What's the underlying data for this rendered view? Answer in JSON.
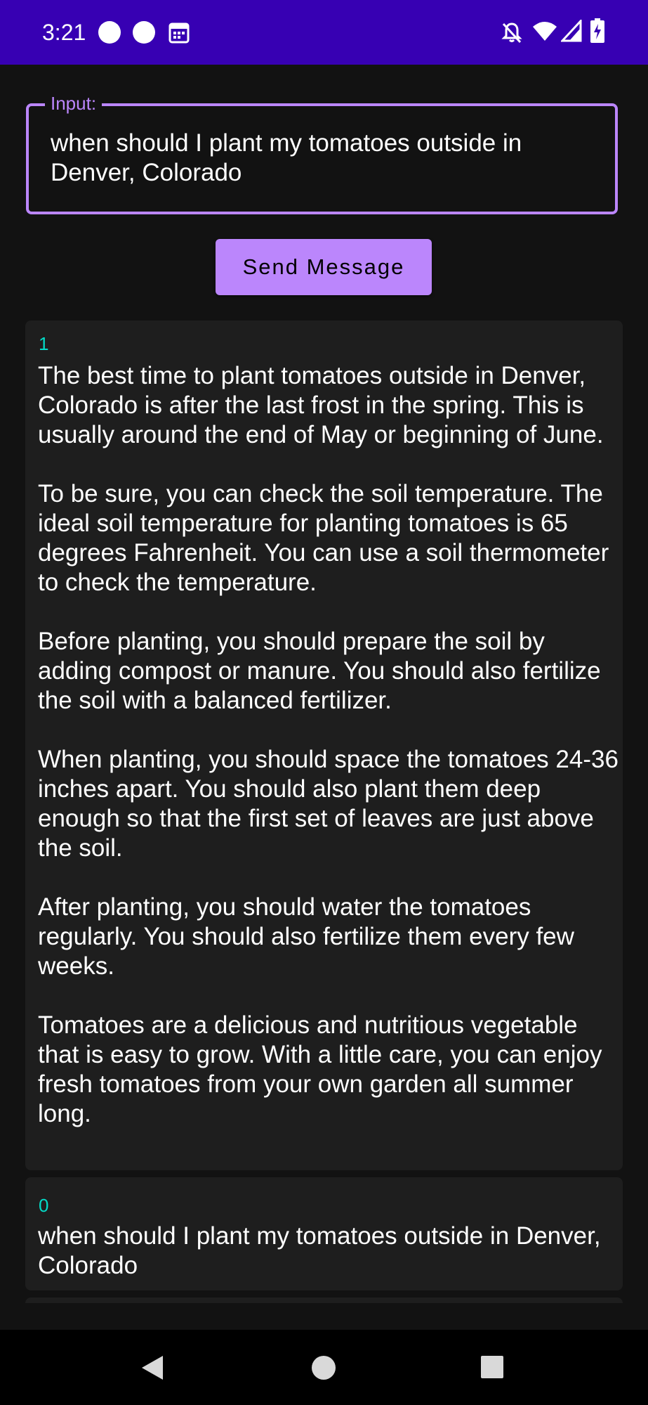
{
  "status_bar": {
    "time": "3:21",
    "icons": [
      "circle-icon",
      "circle-icon",
      "calendar-icon",
      "bell-off-icon",
      "wifi-icon",
      "signal-icon",
      "battery-charging-icon"
    ]
  },
  "input": {
    "label": "Input:",
    "value": "when should I plant my tomatoes outside in Denver, Colorado"
  },
  "send_button": {
    "label": "Send Message"
  },
  "messages": [
    {
      "index": "1",
      "text": "The best time to plant tomatoes outside in Denver, Colorado is after the last frost in the spring. This is usually around the end of May or beginning of June.\n\nTo be sure, you can check the soil temperature. The ideal soil temperature for planting tomatoes is 65 degrees Fahrenheit. You can use a soil thermometer to check the temperature.\n\nBefore planting, you should prepare the soil by adding compost or manure. You should also fertilize the soil with a balanced fertilizer.\n\nWhen planting, you should space the tomatoes 24-36 inches apart. You should also plant them deep enough so that the first set of leaves are just above the soil.\n\nAfter planting, you should water the tomatoes regularly. You should also fertilize them every few weeks.\n\nTomatoes are a delicious and nutritious vegetable that is easy to grow. With a little care, you can enjoy fresh tomatoes from your own garden all summer long."
    },
    {
      "index": "0",
      "text": "when should I plant my tomatoes outside in Denver, Colorado"
    }
  ],
  "nav_bar": {
    "icons": [
      "back-icon",
      "home-icon",
      "recents-icon"
    ]
  },
  "colors": {
    "status_bar": "#3700b3",
    "accent": "#bb86fc",
    "index_text": "#03dac6",
    "background": "#121212",
    "card": "#1e1e1e"
  }
}
